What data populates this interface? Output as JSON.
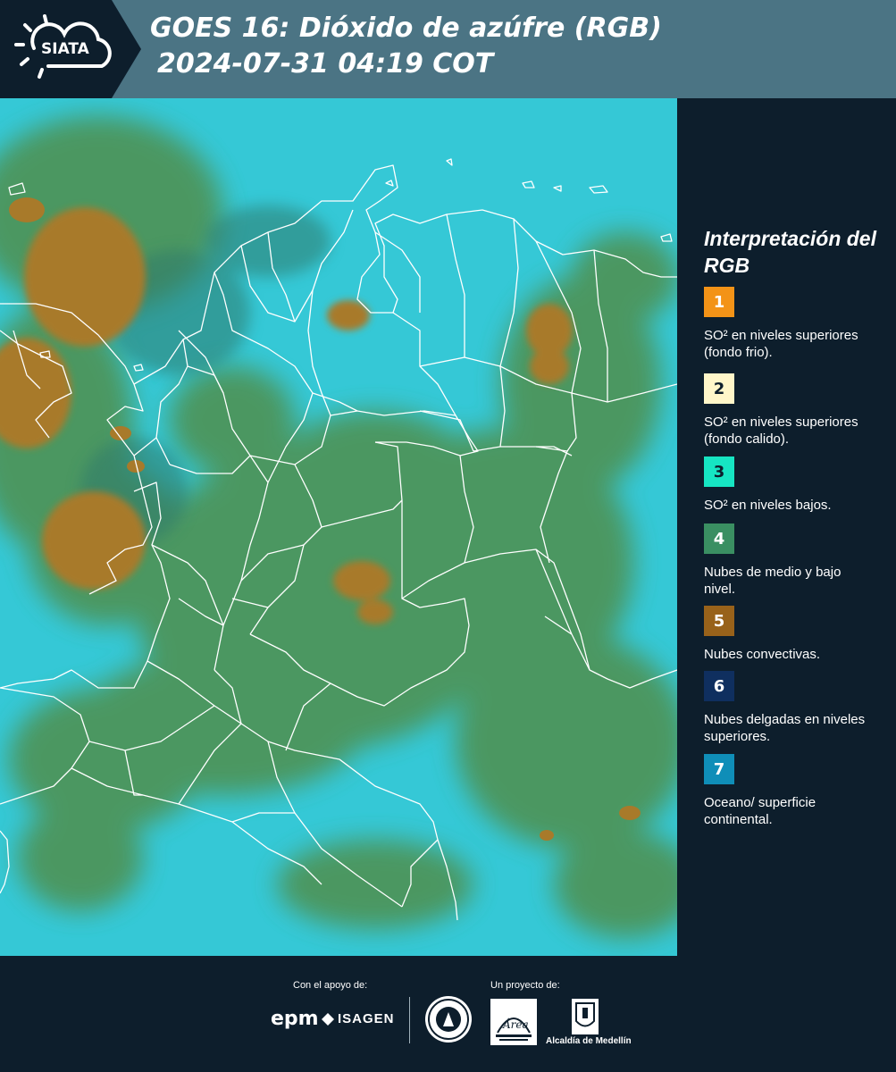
{
  "header": {
    "logo_text": "SIATA",
    "title_line1": "GOES 16: Dióxido de azúfre (RGB)",
    "title_line2": "2024-07-31 04:19 COT"
  },
  "legend": {
    "title": "Interpretación del RGB",
    "items": [
      {
        "number": "1",
        "color": "#f39317",
        "text": "SO² en niveles superiores (fondo frio)."
      },
      {
        "number": "2",
        "color": "#fff6c9",
        "text": "SO² en niveles superiores (fondo calido)."
      },
      {
        "number": "3",
        "color": "#16e5c3",
        "text": "SO² en niveles bajos."
      },
      {
        "number": "4",
        "color": "#3a8f62",
        "text": "Nubes de medio y bajo nivel."
      },
      {
        "number": "5",
        "color": "#98621a",
        "text": "Nubes convectivas."
      },
      {
        "number": "6",
        "color": "#0f2f5f",
        "text": "Nubes delgadas en niveles superiores."
      },
      {
        "number": "7",
        "color": "#0f8eb8",
        "text": "Oceano/ superficie continental."
      }
    ]
  },
  "footer": {
    "support_label": "Con el apoyo de:",
    "project_label": "Un proyecto de:",
    "sponsors": [
      "epm",
      "ISAGEN"
    ],
    "partners": [
      "Área Metropolitana Valle de Aburrá",
      "Alcaldía de Medellín"
    ],
    "alcaldia_label": "Alcaldía de Medellín"
  },
  "map": {
    "background_color": "#35c8d6",
    "cloud_green": "#4f8f4e",
    "convective_color": "#a87a2a",
    "border_color": "#ffffff"
  }
}
